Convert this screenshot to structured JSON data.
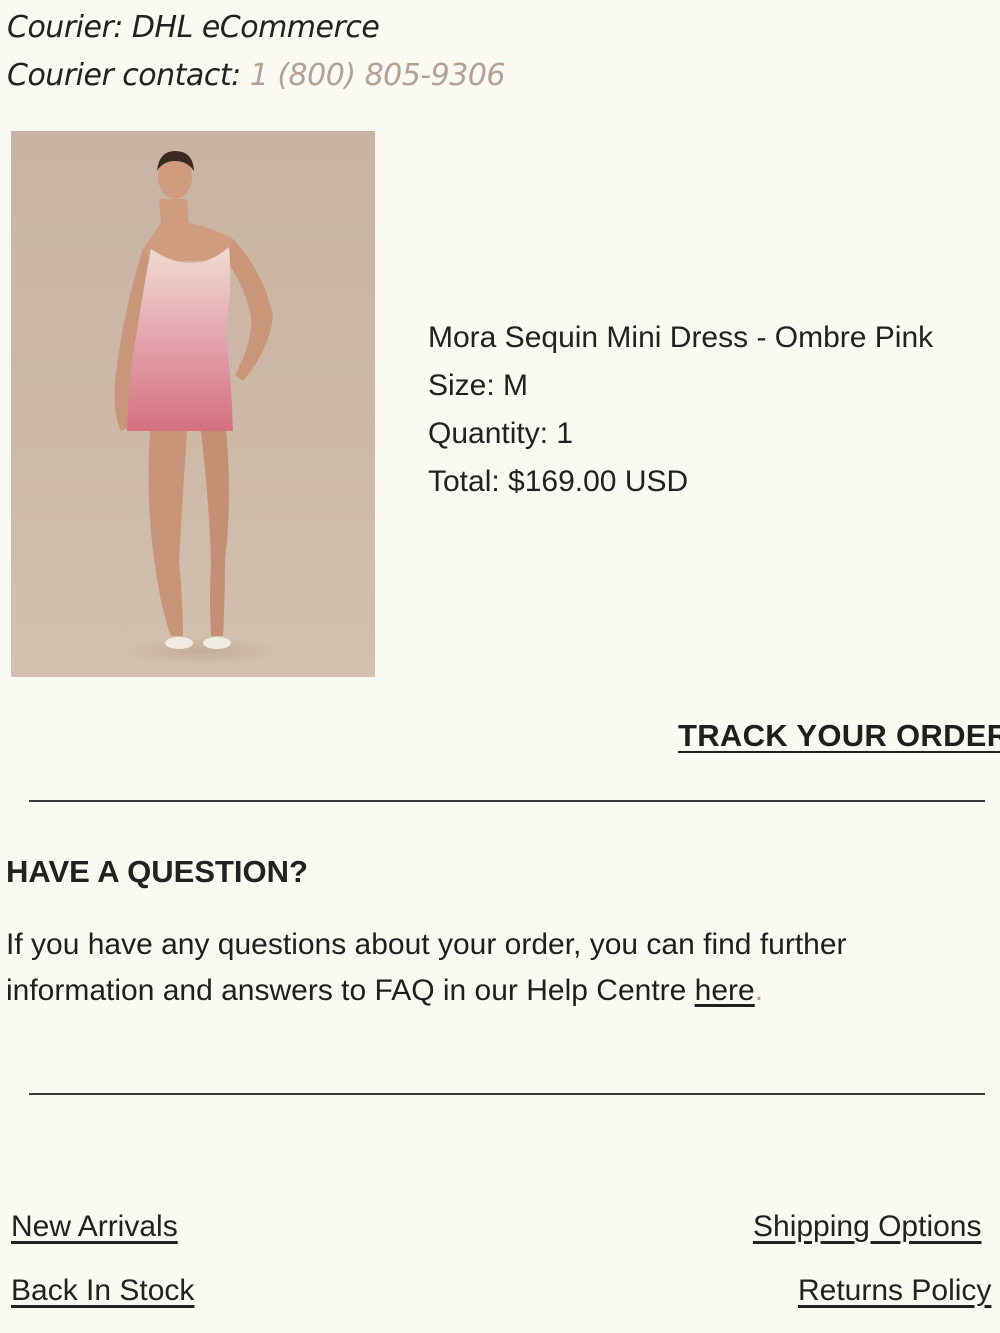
{
  "courier": {
    "courier_label": "Courier: DHL eCommerce",
    "contact_label": "Courier contact: ",
    "contact_phone": "1 (800) 805-9306"
  },
  "product": {
    "name": "Mora Sequin Mini Dress - Ombre Pink",
    "size": "Size: M",
    "quantity": "Quantity: 1",
    "total": "Total: $169.00 USD"
  },
  "track_order_label": "TRACK YOUR ORDER",
  "question": {
    "heading": "HAVE A QUESTION?",
    "text": "If you have any questions about your order, you can find further information and answers to FAQ in our Help Centre ",
    "link_label": "here",
    "period": "."
  },
  "footer": {
    "links": [
      {
        "label": "New Arrivals"
      },
      {
        "label": "Back In Stock"
      },
      {
        "label": "Shipping Options"
      },
      {
        "label": "Returns Policy"
      }
    ]
  },
  "colors": {
    "background": "#faf9f2",
    "accent_link": "#b3a293",
    "dress_top": "#e8d2c8",
    "dress_bottom": "#d77a8c"
  }
}
